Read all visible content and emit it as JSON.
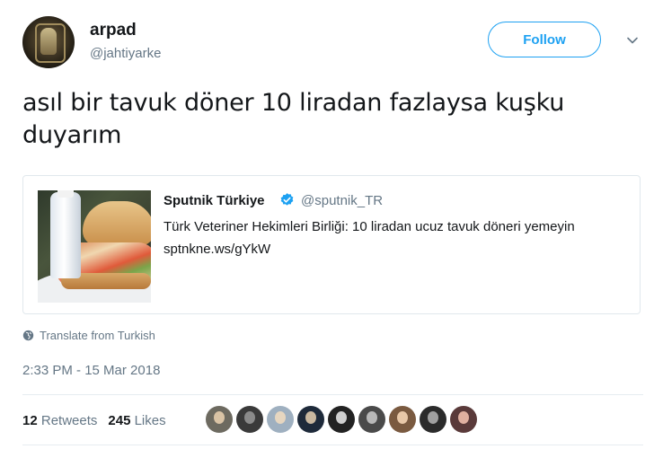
{
  "user": {
    "name": "arpad",
    "handle": "@jahtiyarke"
  },
  "header": {
    "follow_label": "Follow"
  },
  "tweet": {
    "text": "asıl bir tavuk döner 10 liradan fazlaysa kuşku duyarım"
  },
  "quoted": {
    "name": "Sputnik Türkiye",
    "handle": "@sputnik_TR",
    "text": "Türk Veteriner Hekimleri Birliği: 10 liradan ucuz tavuk döneri yemeyin sptnkne.ws/gYkW",
    "verified_color": "#1da1f2"
  },
  "translate_label": "Translate from Turkish",
  "timestamp": "2:33 PM - 15 Mar 2018",
  "stats": {
    "retweets_count": "12",
    "retweets_label": "Retweets",
    "likes_count": "245",
    "likes_label": "Likes"
  },
  "likers": [
    {
      "bg": "#6d6a60",
      "face": "#d9c3a5"
    },
    {
      "bg": "#3a3a3a",
      "face": "#8a8a8a"
    },
    {
      "bg": "#9fb0c0",
      "face": "#e6d6c0"
    },
    {
      "bg": "#1e2a3a",
      "face": "#c9b8a0"
    },
    {
      "bg": "#222222",
      "face": "#cfcfcf"
    },
    {
      "bg": "#4a4a4a",
      "face": "#b8b8b8"
    },
    {
      "bg": "#7a5a40",
      "face": "#e8c8a8"
    },
    {
      "bg": "#2b2b2b",
      "face": "#a0a0a0"
    },
    {
      "bg": "#5a3a3a",
      "face": "#e0b0a0"
    }
  ],
  "colors": {
    "accent": "#1da1f2",
    "muted": "#657786",
    "text": "#14171a"
  }
}
